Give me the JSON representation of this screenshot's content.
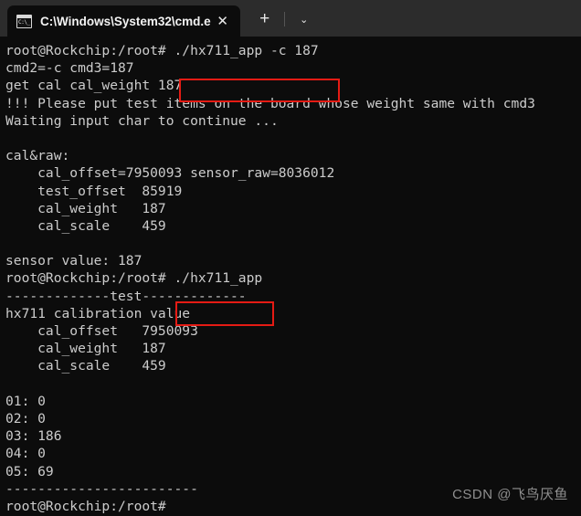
{
  "window": {
    "tab": {
      "icon": "cmd-console-icon",
      "icon_text": "C:\\_",
      "title": "C:\\Windows\\System32\\cmd.e",
      "close_label": "✕"
    },
    "new_tab_label": "+",
    "dropdown_label": "⌄"
  },
  "terminal": {
    "lines": [
      "root@Rockchip:/root# ./hx711_app -c 187",
      "cmd2=-c cmd3=187",
      "get cal cal_weight 187",
      "!!! Please put test items on the board whose weight same with cmd3",
      "Waiting input char to continue ...",
      "",
      "cal&raw:",
      "    cal_offset=7950093 sensor_raw=8036012",
      "    test_offset  85919",
      "    cal_weight   187",
      "    cal_scale    459",
      "",
      "sensor value: 187",
      "root@Rockchip:/root# ./hx711_app",
      "-------------test-------------",
      "hx711 calibration value",
      "    cal_offset   7950093",
      "    cal_weight   187",
      "    cal_scale    459",
      "",
      "01: 0",
      "02: 0",
      "03: 186",
      "04: 0",
      "05: 69",
      "------------------------",
      "root@Rockchip:/root#"
    ]
  },
  "annotations": {
    "highlight_1_text": "./hx711_app -c 187",
    "highlight_2_text": "./hx711_app",
    "highlight_color": "#e51b14"
  },
  "watermark": {
    "text": "CSDN @飞鸟厌鱼"
  }
}
